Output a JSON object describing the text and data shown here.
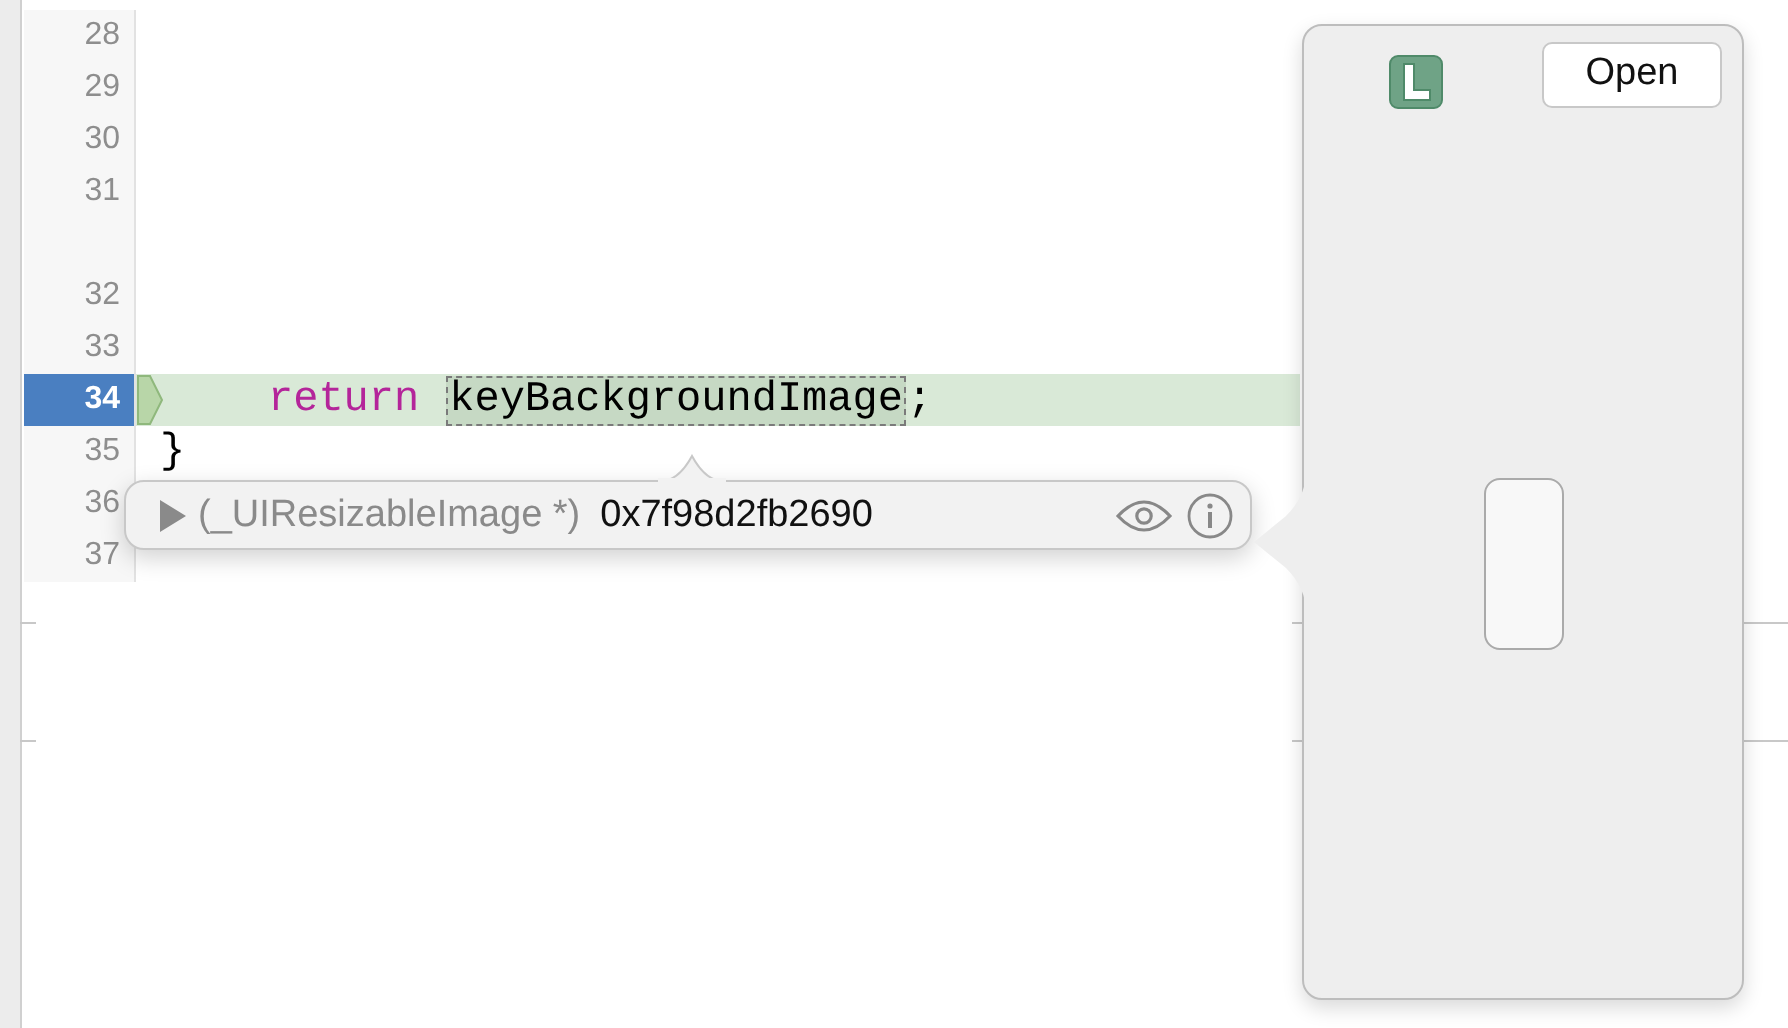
{
  "editor": {
    "lines": [
      {
        "number": "28",
        "current": false,
        "kind": "plain"
      },
      {
        "number": "29",
        "current": false,
        "kind": "plain"
      },
      {
        "number": "30",
        "current": false,
        "kind": "plain"
      },
      {
        "number": "31",
        "current": false,
        "kind": "wrapped"
      },
      {
        "number": "32",
        "current": false,
        "kind": "plain"
      },
      {
        "number": "33",
        "current": false,
        "kind": "plain"
      },
      {
        "number": "34",
        "current": true,
        "kind": "plain",
        "tokens": [
          {
            "text": "return",
            "kind": "keyword"
          },
          {
            "text": "keyBackgroundImage",
            "kind": "inspected"
          },
          {
            "text": ";",
            "kind": "plain"
          }
        ]
      },
      {
        "number": "35",
        "current": false,
        "kind": "plain",
        "tokens": [
          {
            "text": "}",
            "kind": "plain"
          }
        ]
      },
      {
        "number": "36",
        "current": false,
        "kind": "plain"
      },
      {
        "number": "37",
        "current": false,
        "kind": "plain"
      }
    ]
  },
  "variable_popover": {
    "type": "(_UIResizableImage *)",
    "value": "0x7f98d2fb2690",
    "expanded": false
  },
  "quick_look": {
    "open_button": "Open"
  }
}
